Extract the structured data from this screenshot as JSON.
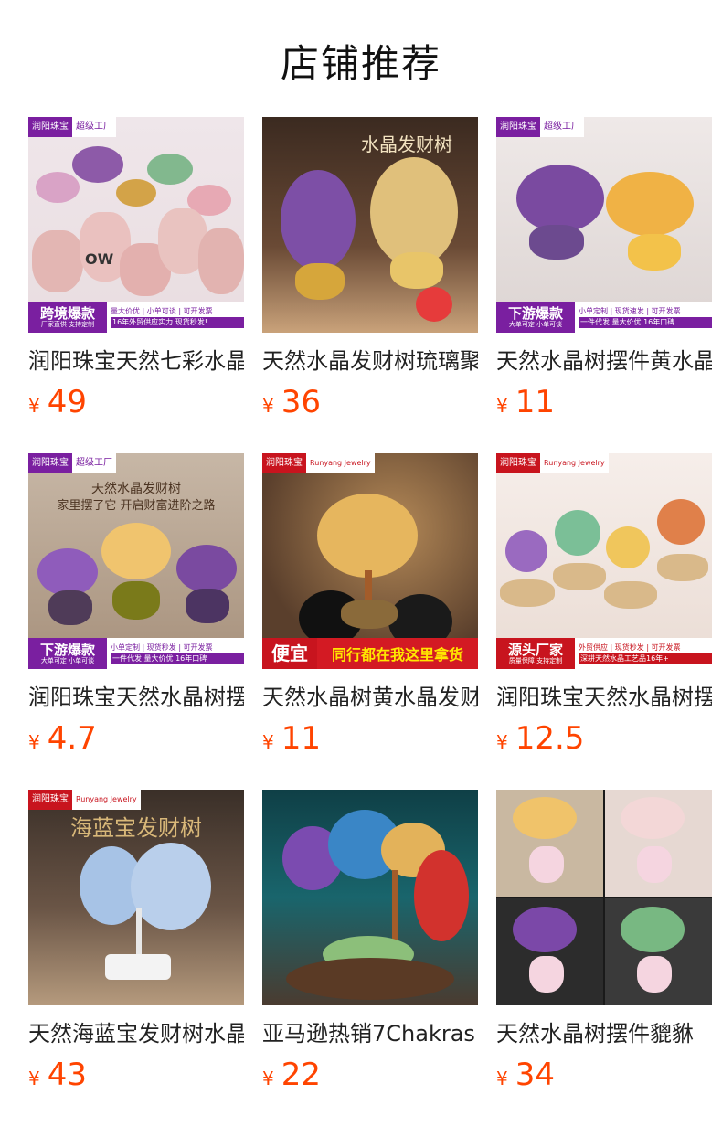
{
  "section_title": "店铺推荐",
  "currency_symbol": "¥",
  "products": [
    {
      "name": "润阳珠宝天然七彩水晶发财树",
      "price": "49",
      "image": {
        "brand": "润阳珠宝",
        "brand_sub": "超级工厂",
        "banner_tag": "跨境爆款",
        "banner_tag_sub": "厂家直供 支持定制",
        "banner_line1": "量大价优 | 小单可谈 | 可开发票",
        "banner_line2": "16年外贸供应实力 现货秒发!",
        "text": "OW"
      }
    },
    {
      "name": "天然水晶发财树琉璃聚宝盆",
      "price": "36",
      "image": {
        "overlay_title": "水晶发财树"
      }
    },
    {
      "name": "天然水晶树摆件黄水晶发财树",
      "price": "11",
      "image": {
        "brand": "润阳珠宝",
        "brand_sub": "超级工厂",
        "banner_tag": "下游爆款",
        "banner_tag_sub": "大单可定 小单可谈",
        "banner_line1": "小单定制 | 现货速发 | 可开发票",
        "banner_line2": "一件代发 量大价优 16年口碑"
      }
    },
    {
      "name": "润阳珠宝天然水晶树摆件",
      "price": "4.7",
      "image": {
        "brand": "润阳珠宝",
        "brand_sub": "超级工厂",
        "overlay_line1": "天然水晶发财树",
        "overlay_line2": "家里摆了它 开启财富进阶之路",
        "banner_tag": "下游爆款",
        "banner_tag_sub": "大单可定 小单可谈",
        "banner_line1": "小单定制 | 现货秒发 | 可开发票",
        "banner_line2": "一件代发 量大价优 16年口碑"
      }
    },
    {
      "name": "天然水晶树黄水晶发财树",
      "price": "11",
      "image": {
        "brand": "润阳珠宝",
        "brand_en": "Runyang Jewelry",
        "banner_tag": "便宜",
        "banner_slogan": "同行都在我这里拿货"
      }
    },
    {
      "name": "润阳珠宝天然水晶树摆件",
      "price": "12.5",
      "image": {
        "brand": "润阳珠宝",
        "brand_en": "Runyang Jewelry",
        "banner_tag": "源头厂家",
        "banner_tag_sub": "质量保障 支持定制",
        "banner_line1": "外贸供应 | 现货秒发 | 可开发票",
        "banner_line2": "深耕天然水晶工艺品16年+"
      }
    },
    {
      "name": "天然海蓝宝发财树水晶",
      "price": "43",
      "image": {
        "brand": "润阳珠宝",
        "brand_en": "Runyang Jewelry",
        "overlay_title": "海蓝宝发财树"
      }
    },
    {
      "name": "亚马逊热销7Chakras",
      "price": "22",
      "image": {}
    },
    {
      "name": "天然水晶树摆件貔貅",
      "price": "34",
      "image": {}
    }
  ]
}
